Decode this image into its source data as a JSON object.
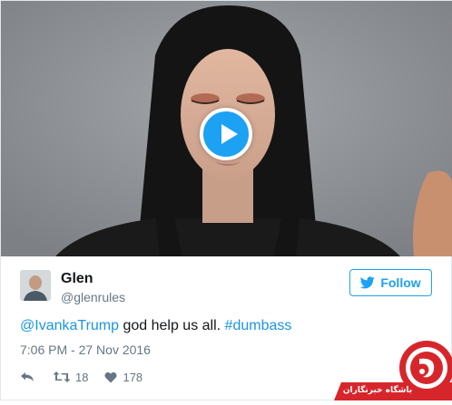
{
  "media": {
    "type": "video",
    "play_icon": "play-icon"
  },
  "tweet": {
    "author_name": "Glen",
    "author_handle": "@glenrules",
    "follow_label": "Follow",
    "text_mention": "@IvankaTrump",
    "text_body": " god help us all. ",
    "text_hashtag": "#dumbass",
    "timestamp": "7:06 PM - 27 Nov 2016",
    "retweets": "18",
    "likes": "178",
    "icons": [
      "reply-icon",
      "retweet-icon",
      "heart-icon",
      "twitter-bird-icon"
    ]
  },
  "watermark": {
    "text": "باشگاه خبرنگاران"
  },
  "colors": {
    "accent": "#1da1f2",
    "link": "#1b95e0",
    "muted": "#657786",
    "watermark_red": "#d7262b"
  }
}
